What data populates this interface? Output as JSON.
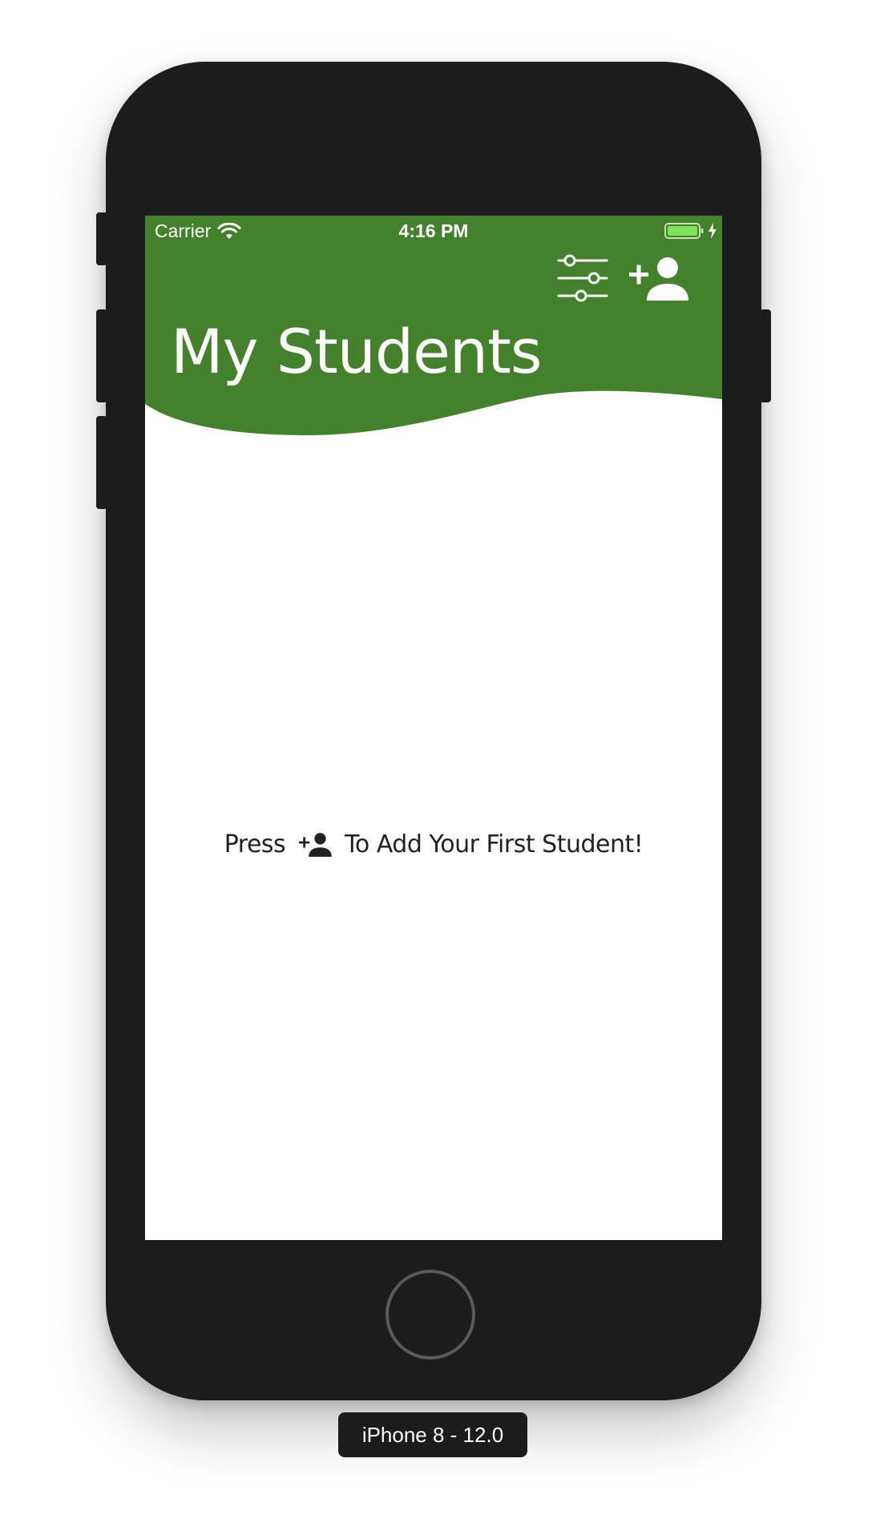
{
  "status_bar": {
    "carrier": "Carrier",
    "time": "4:16 PM"
  },
  "header": {
    "title": "My Students",
    "background_color": "#43822a",
    "icons": [
      "sliders-icon",
      "add-person-icon"
    ]
  },
  "empty_state": {
    "prefix": "Press",
    "suffix": "To Add Your First Student!",
    "icon": "add-person-icon"
  },
  "device": {
    "label": "iPhone 8 - 12.0"
  }
}
